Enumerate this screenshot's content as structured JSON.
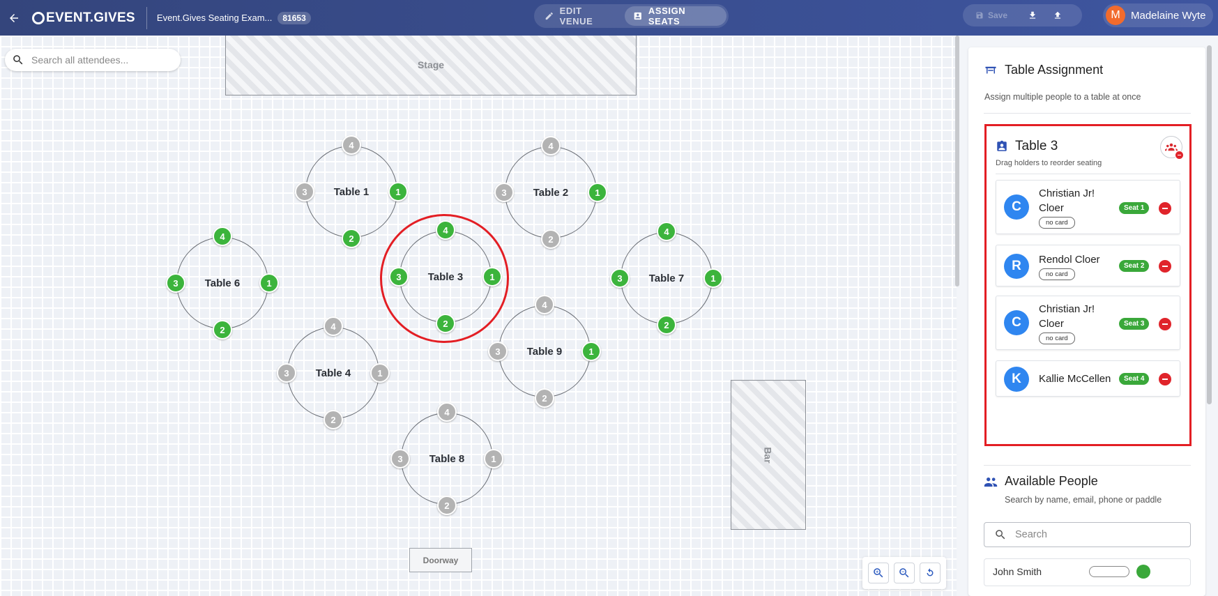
{
  "header": {
    "logo": "EVENT.GIVES",
    "event_name": "Event.Gives Seating Exam...",
    "event_id": "81653",
    "modes": [
      {
        "label": "EDIT VENUE",
        "active": false
      },
      {
        "label": "ASSIGN SEATS",
        "active": true
      }
    ],
    "save_label": "Save",
    "user": {
      "initial": "M",
      "name": "Madelaine Wyte",
      "avatar_color": "#f26b2d"
    }
  },
  "canvas": {
    "search_placeholder": "Search all attendees...",
    "stage_label": "Stage",
    "bar_label": "Bar",
    "doorway_label": "Doorway",
    "tables": [
      {
        "id": "table-1",
        "label": "Table 1",
        "seats_taken": [
          1,
          2
        ],
        "seats": [
          1,
          2,
          3,
          4
        ]
      },
      {
        "id": "table-2",
        "label": "Table 2",
        "seats_taken": [
          1
        ],
        "seats": [
          1,
          2,
          3,
          4
        ]
      },
      {
        "id": "table-3",
        "label": "Table 3",
        "seats_taken": [
          1,
          2,
          3,
          4
        ],
        "seats": [
          1,
          2,
          3,
          4
        ],
        "selected": true
      },
      {
        "id": "table-4",
        "label": "Table 4",
        "seats_taken": [],
        "seats": [
          1,
          2,
          3,
          4
        ]
      },
      {
        "id": "table-6",
        "label": "Table 6",
        "seats_taken": [
          1,
          2,
          3,
          4
        ],
        "seats": [
          1,
          2,
          3,
          4
        ]
      },
      {
        "id": "table-7",
        "label": "Table 7",
        "seats_taken": [
          1,
          2,
          3,
          4
        ],
        "seats": [
          1,
          2,
          3,
          4
        ]
      },
      {
        "id": "table-8",
        "label": "Table 8",
        "seats_taken": [],
        "seats": [
          1,
          2,
          3,
          4
        ]
      },
      {
        "id": "table-9",
        "label": "Table 9",
        "seats_taken": [
          1
        ],
        "seats": [
          1,
          2,
          3,
          4
        ]
      }
    ],
    "colors": {
      "taken": "#3cb43c",
      "empty": "#b3b3b3",
      "selected": "#e31e24"
    }
  },
  "panel": {
    "title": "Table Assignment",
    "subtitle": "Assign multiple people to a table at once",
    "selected_table": {
      "title": "Table 3",
      "subtitle": "Drag holders to reorder seating",
      "holders": [
        {
          "initial": "C",
          "name": "Christian Jr! Cloer",
          "card": "no card",
          "seat": "Seat 1"
        },
        {
          "initial": "R",
          "name": "Rendol Cloer",
          "card": "no card",
          "seat": "Seat 2"
        },
        {
          "initial": "C",
          "name": "Christian Jr! Cloer",
          "card": "no card",
          "seat": "Seat 3"
        },
        {
          "initial": "K",
          "name": "Kallie McCellen",
          "card": "",
          "seat": "Seat 4"
        }
      ]
    },
    "available": {
      "title": "Available People",
      "subtitle": "Search by name, email, phone or paddle",
      "search_placeholder": "Search",
      "peek_name": "John Smith"
    }
  }
}
